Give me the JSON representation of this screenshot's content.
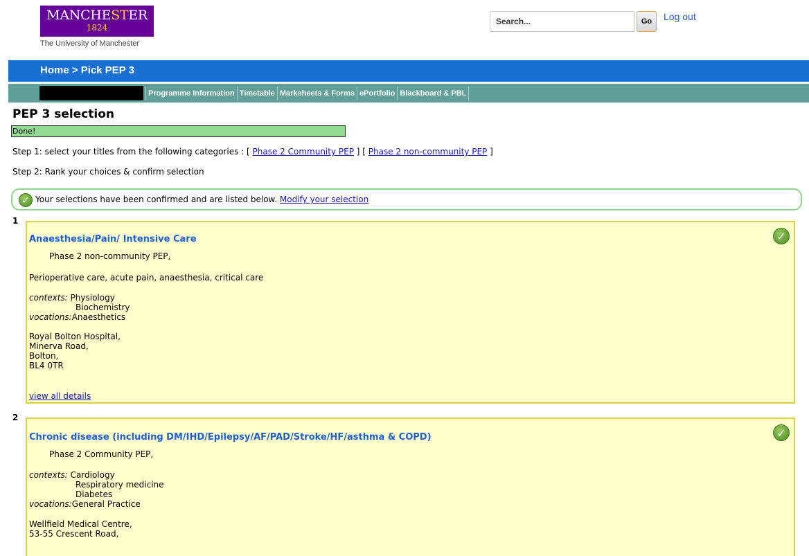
{
  "header": {
    "logo": {
      "name_pre": "MANCHE",
      "name_accent": "ST",
      "name_post": "ER",
      "year": "1824",
      "subtitle": "The University of Manchester"
    },
    "search": {
      "placeholder": "Search...",
      "go_label": "Go"
    },
    "logout_label": "Log out"
  },
  "breadcrumb": "Home > Pick PEP 3",
  "nav": [
    "Programme Information",
    "Timetable",
    "Marksheets & Forms",
    "ePortfolio",
    "Blackboard & PBL"
  ],
  "page": {
    "title": "PEP 3 selection",
    "status": "Done!",
    "step1_prefix": "Step 1: select your titles from the following categories : [",
    "step1_link1": "Phase 2 Community PEP",
    "step1_mid": "] [",
    "step1_link2": "Phase 2 non-community PEP",
    "step1_suffix": "]",
    "step2": "Step 2: Rank your choices & confirm selection",
    "confirm_text": "Your selections have been confirmed and are listed below.",
    "modify_link": "Modify your selection"
  },
  "selections": [
    {
      "rank": "1",
      "title": "Anaesthesia/Pain/ Intensive Care",
      "type": "Phase 2 non-community PEP,",
      "description": "Perioperative care, acute pain, anaesthesia, critical care",
      "contexts_label": "contexts:",
      "contexts": [
        "Physiology",
        "Biochemistry"
      ],
      "vocations_label": "vocations:",
      "vocations": "Anaesthetics",
      "address": [
        "Royal Bolton Hospital,",
        "Minerva Road,",
        "Bolton,",
        "BL4 0TR"
      ],
      "details_link": "view all details"
    },
    {
      "rank": "2",
      "title": "Chronic disease (including DM/IHD/Epilepsy/AF/PAD/Stroke/HF/asthma & COPD)",
      "type": "Phase 2 Community PEP,",
      "contexts_label": "contexts:",
      "contexts": [
        "Cardiology",
        "Respiratory medicine",
        "Diabetes"
      ],
      "vocations_label": "vocations:",
      "vocations": "General Practice",
      "address": [
        "Wellfield Medical Centre,",
        "53-55 Crescent Road,"
      ]
    }
  ],
  "colors": {
    "header_bar": "#1a6fd3",
    "nav_bar": "#619f99",
    "status_green": "#93da93",
    "card_bg": "#ffffcc",
    "card_border": "#d8d43f",
    "title_blue": "#1f5fd6",
    "logo_purple": "#660099"
  }
}
